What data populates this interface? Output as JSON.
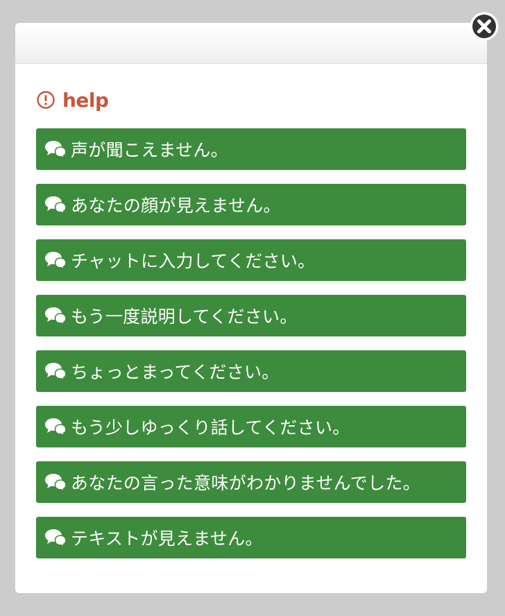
{
  "dialog": {
    "title": "help",
    "close_icon": "close-icon",
    "title_icon": "alert-circle-icon",
    "accent_color": "#c9553a",
    "button_color": "#3d8b3d"
  },
  "phrases": [
    {
      "label": "声が聞こえません。",
      "icon": "chat-bubbles-icon"
    },
    {
      "label": "あなたの顔が見えません。",
      "icon": "chat-bubbles-icon"
    },
    {
      "label": "チャットに入力してください。",
      "icon": "chat-bubbles-icon"
    },
    {
      "label": "もう一度説明してください。",
      "icon": "chat-bubbles-icon"
    },
    {
      "label": "ちょっとまってください。",
      "icon": "chat-bubbles-icon"
    },
    {
      "label": "もう少しゆっくり話してください。",
      "icon": "chat-bubbles-icon"
    },
    {
      "label": "あなたの言った意味がわかりませんでした。",
      "icon": "chat-bubbles-icon"
    },
    {
      "label": "テキストが見えません。",
      "icon": "chat-bubbles-icon"
    }
  ]
}
